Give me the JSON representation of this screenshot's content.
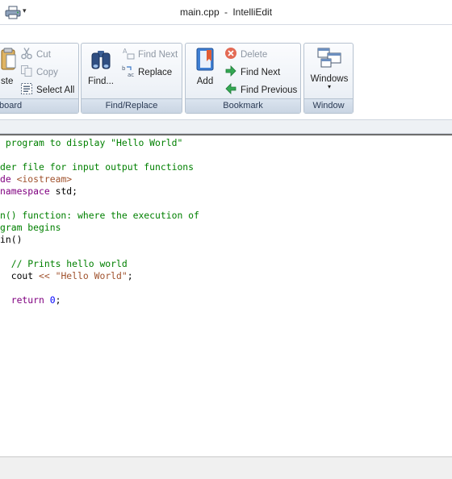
{
  "window": {
    "file_name": "main.cpp",
    "separator": "-",
    "app_name": "IntelliEdit"
  },
  "qat": {
    "icon": "print-icon",
    "arrow": "▾"
  },
  "ribbon": {
    "clipboard": {
      "label": "board",
      "paste_label": "ste",
      "cut_label": "Cut",
      "copy_label": "Copy",
      "select_all_label": "Select All"
    },
    "find_replace": {
      "label": "Find/Replace",
      "find_label": "Find...",
      "find_next_label": "Find Next",
      "replace_label": "Replace"
    },
    "bookmark": {
      "label": "Bookmark",
      "add_label": "Add",
      "delete_label": "Delete",
      "find_next_label": "Find Next",
      "find_previous_label": "Find Previous"
    },
    "window": {
      "label": "Window",
      "windows_label": "Windows",
      "dropdown_arrow": "▾"
    }
  },
  "editor": {
    "lines": [
      [
        {
          "t": " program to display \"Hello World\"",
          "c": "comment"
        }
      ],
      [],
      [
        {
          "t": "der file for input output functions",
          "c": "comment"
        }
      ],
      [
        {
          "t": "de ",
          "c": "kw"
        },
        {
          "t": "<iostream>",
          "c": "str"
        }
      ],
      [
        {
          "t": "namespace",
          "c": "kw"
        },
        {
          "t": " std;",
          "c": "plain"
        }
      ],
      [],
      [
        {
          "t": "n() function: where the execution of",
          "c": "comment"
        }
      ],
      [
        {
          "t": "gram begins",
          "c": "comment"
        }
      ],
      [
        {
          "t": "in()",
          "c": "plain"
        }
      ],
      [],
      [
        {
          "t": "  // Prints hello world",
          "c": "comment"
        }
      ],
      [
        {
          "t": "  cout ",
          "c": "plain"
        },
        {
          "t": "<<",
          "c": "str"
        },
        {
          "t": " ",
          "c": "plain"
        },
        {
          "t": "\"Hello World\"",
          "c": "str"
        },
        {
          "t": ";",
          "c": "plain"
        }
      ],
      [],
      [
        {
          "t": "  ",
          "c": "plain"
        },
        {
          "t": "return",
          "c": "kw"
        },
        {
          "t": " ",
          "c": "plain"
        },
        {
          "t": "0",
          "c": "num"
        },
        {
          "t": ";",
          "c": "plain"
        }
      ]
    ]
  }
}
